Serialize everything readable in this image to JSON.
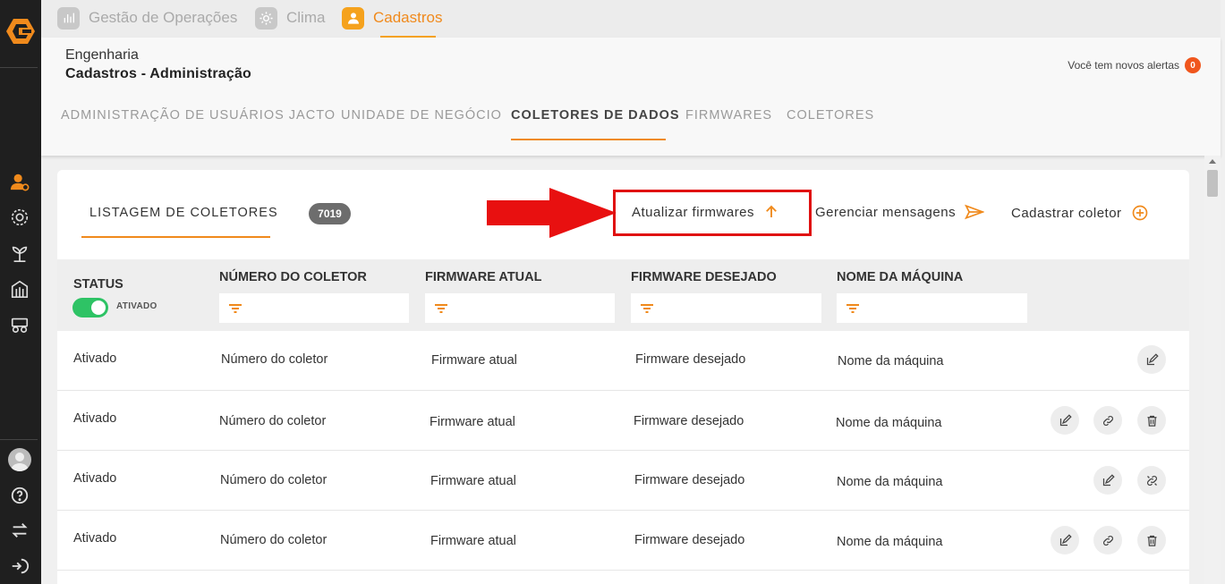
{
  "app": {
    "modules": [
      {
        "label": "Gestão de Operações",
        "icon": "chart-icon"
      },
      {
        "label": "Clima",
        "icon": "sun-icon"
      },
      {
        "label": "Cadastros",
        "icon": "user-icon",
        "active": true
      }
    ],
    "sidebar_icons": [
      "admin-user-icon",
      "gear-icon",
      "plant-icon",
      "building-icon",
      "tractor-icon"
    ],
    "sidebar_bottom_icons": [
      "avatar",
      "help-icon",
      "swap-icon",
      "logout-icon"
    ]
  },
  "header": {
    "crumb_parent": "Engenharia",
    "crumb_title": "Cadastros - Administração",
    "alerts_text": "Você tem novos alertas",
    "alerts_count": "0"
  },
  "subtabs": [
    {
      "label": "ADMINISTRAÇÃO DE USUÁRIOS JACTO"
    },
    {
      "label": "UNIDADE DE NEGÓCIO"
    },
    {
      "label": "COLETORES DE DADOS",
      "active": true
    },
    {
      "label": "FIRMWARES"
    },
    {
      "label": "COLETORES"
    }
  ],
  "listing": {
    "title": "LISTAGEM DE COLETORES",
    "count": "7019",
    "actions": {
      "update_firmwares": "Atualizar firmwares",
      "manage_messages": "Gerenciar mensagens",
      "register_collector": "Cadastrar coletor"
    }
  },
  "table": {
    "headers": {
      "status": "STATUS",
      "status_toggle": "ATIVADO",
      "collector_number": "NÚMERO DO COLETOR",
      "current_firmware": "FIRMWARE ATUAL",
      "desired_firmware": "FIRMWARE DESEJADO",
      "machine_name": "NOME DA MÁQUINA"
    },
    "rows": [
      {
        "status": "Ativado",
        "number": "Número do coletor",
        "current": "Firmware atual",
        "desired": "Firmware desejado",
        "machine": "Nome da máquina",
        "actions": [
          "edit"
        ]
      },
      {
        "status": "Ativado",
        "number": "Número do coletor",
        "current": "Firmware atual",
        "desired": "Firmware desejado",
        "machine": "Nome da máquina",
        "actions": [
          "edit",
          "link",
          "delete"
        ]
      },
      {
        "status": "Ativado",
        "number": "Número do coletor",
        "current": "Firmware atual",
        "desired": "Firmware desejado",
        "machine": "Nome da máquina",
        "actions": [
          "edit",
          "unlink"
        ]
      },
      {
        "status": "Ativado",
        "number": "Número do coletor",
        "current": "Firmware atual",
        "desired": "Firmware desejado",
        "machine": "Nome da máquina",
        "actions": [
          "edit",
          "link",
          "delete"
        ]
      }
    ]
  },
  "colors": {
    "accent": "#f08a1c",
    "sidebar": "#1f1f1f",
    "highlight": "#e01010",
    "toggle_on": "#2ec365",
    "badge": "#f0561d"
  }
}
